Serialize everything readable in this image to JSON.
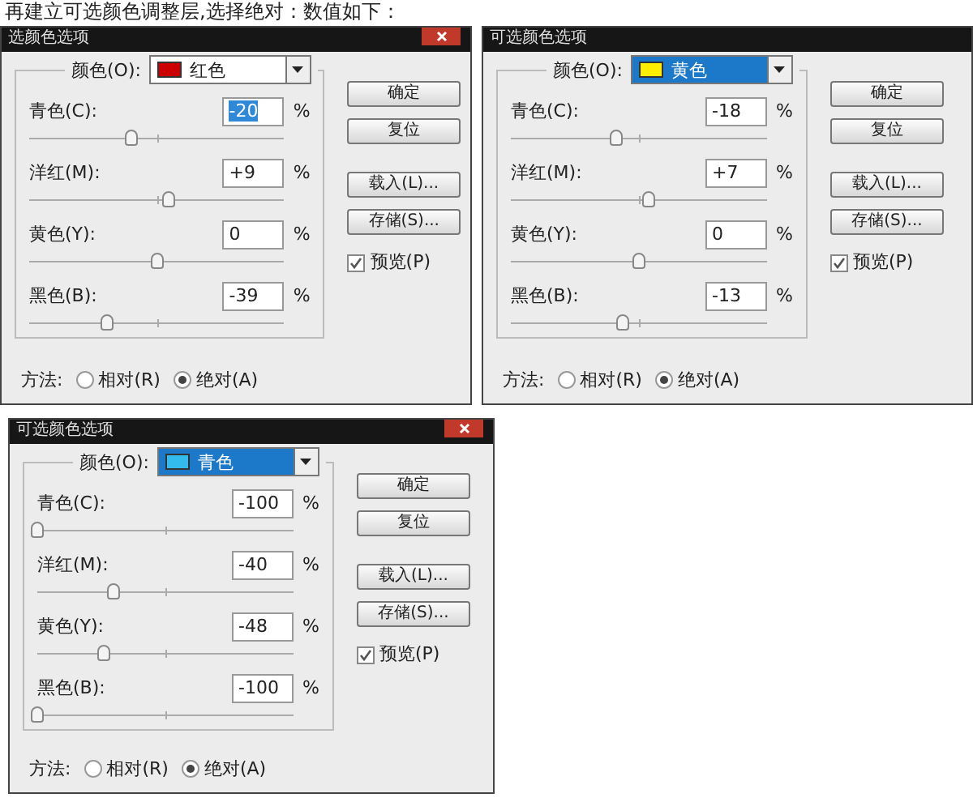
{
  "caption": "再建立可选颜色调整层,选择绝对：数值如下：",
  "dialogs": [
    {
      "title": "选颜色选项",
      "close_button": true,
      "color_field": {
        "label": "颜色(O):",
        "value": "红色",
        "color": "#cc0000",
        "highlighted": false
      },
      "sliders": [
        {
          "label": "青色(C):",
          "value": "-20",
          "value_highlighted": true,
          "unit": "%",
          "level": 0.4
        },
        {
          "label": "洋红(M):",
          "value": "+9",
          "value_highlighted": false,
          "unit": "%",
          "level": 0.545
        },
        {
          "label": "黄色(Y):",
          "value": "0",
          "value_highlighted": false,
          "unit": "%",
          "level": 0.5
        },
        {
          "label": "黑色(B):",
          "value": "-39",
          "value_highlighted": false,
          "unit": "%",
          "level": 0.305
        }
      ],
      "buttons": [
        "确定",
        "复位",
        "载入(L)...",
        "存储(S)..."
      ],
      "preview": {
        "label": "预览(P)",
        "checked": true
      },
      "method": {
        "label": "方法:",
        "options": [
          {
            "label": "相对(R)",
            "selected": false
          },
          {
            "label": "绝对(A)",
            "selected": true
          }
        ]
      }
    },
    {
      "title": "可选颜色选项",
      "close_button": false,
      "color_field": {
        "label": "颜色(O):",
        "value": "黄色",
        "color": "#ffee00",
        "highlighted": true
      },
      "sliders": [
        {
          "label": "青色(C):",
          "value": "-18",
          "value_highlighted": false,
          "unit": "%",
          "level": 0.41
        },
        {
          "label": "洋红(M):",
          "value": "+7",
          "value_highlighted": false,
          "unit": "%",
          "level": 0.535
        },
        {
          "label": "黄色(Y):",
          "value": "0",
          "value_highlighted": false,
          "unit": "%",
          "level": 0.5
        },
        {
          "label": "黑色(B):",
          "value": "-13",
          "value_highlighted": false,
          "unit": "%",
          "level": 0.435
        }
      ],
      "buttons": [
        "确定",
        "复位",
        "载入(L)...",
        "存储(S)..."
      ],
      "preview": {
        "label": "预览(P)",
        "checked": true
      },
      "method": {
        "label": "方法:",
        "options": [
          {
            "label": "相对(R)",
            "selected": false
          },
          {
            "label": "绝对(A)",
            "selected": true
          }
        ]
      }
    },
    {
      "title": "可选颜色选项",
      "close_button": true,
      "color_field": {
        "label": "颜色(O):",
        "value": "青色",
        "color": "#33bbee",
        "highlighted": true
      },
      "sliders": [
        {
          "label": "青色(C):",
          "value": "-100",
          "value_highlighted": false,
          "unit": "%",
          "level": 0
        },
        {
          "label": "洋红(M):",
          "value": "-40",
          "value_highlighted": false,
          "unit": "%",
          "level": 0.3
        },
        {
          "label": "黄色(Y):",
          "value": "-48",
          "value_highlighted": false,
          "unit": "%",
          "level": 0.26
        },
        {
          "label": "黑色(B):",
          "value": "-100",
          "value_highlighted": false,
          "unit": "%",
          "level": 0
        }
      ],
      "buttons": [
        "确定",
        "复位",
        "载入(L)...",
        "存储(S)..."
      ],
      "preview": {
        "label": "预览(P)",
        "checked": true
      },
      "method": {
        "label": "方法:",
        "options": [
          {
            "label": "相对(R)",
            "selected": false
          },
          {
            "label": "绝对(A)",
            "selected": true
          }
        ]
      }
    }
  ]
}
